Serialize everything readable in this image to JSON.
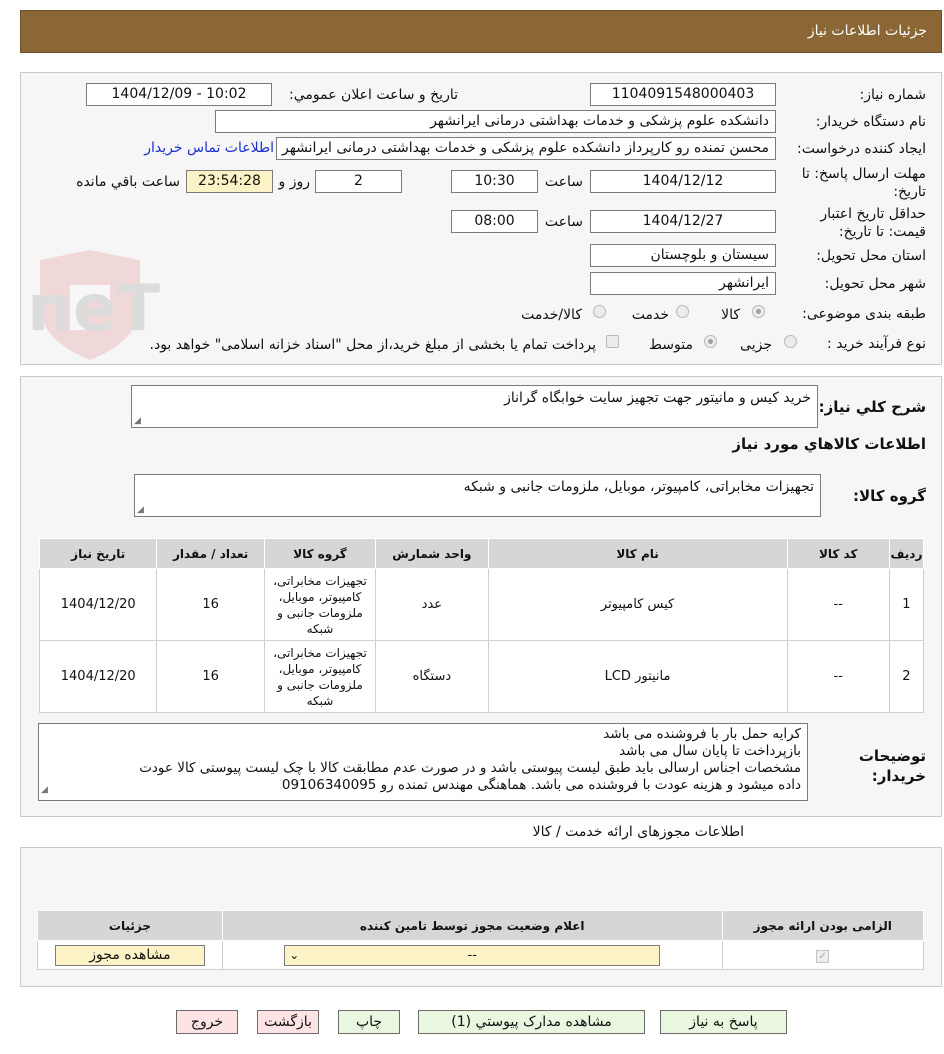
{
  "header": {
    "title": "جزئیات اطلاعات نیاز"
  },
  "watermark": {
    "text": "AriaTender.neT"
  },
  "form": {
    "need_number_label": "شماره نیاز:",
    "need_number": "1104091548000403",
    "announce_label": "تاريخ و ساعت اعلان عمومي:",
    "announce_value": "1404/12/09 - 10:02",
    "buyer_org_label": "نام دستگاه خریدار:",
    "buyer_org": "دانشکده علوم پزشکی و خدمات بهداشتی درمانی ایرانشهر",
    "requester_label": "ایجاد کننده درخواست:",
    "requester": "محسن تمنده رو کارپرداز دانشکده علوم پزشکی و خدمات بهداشتی درمانی ایرانشهر",
    "contact_link": "اطلاعات تماس خریدار",
    "deadline_label": "مهلت ارسال پاسخ: تا تاریخ:",
    "deadline_date": "1404/12/12",
    "time_label": "ساعت",
    "deadline_time": "10:30",
    "days_value": "2",
    "days_label": "روز و",
    "remaining_time": "23:54:28",
    "remaining_label": "ساعت باقي مانده",
    "validity_label": "حداقل تاریخ اعتبار قیمت: تا تاریخ:",
    "validity_date": "1404/12/27",
    "validity_time": "08:00",
    "province_label": "استان محل تحویل:",
    "province": "سیستان و بلوچستان",
    "city_label": "شهر محل تحویل:",
    "city": "ایرانشهر",
    "category_label": "طبقه بندی موضوعی:",
    "category_options": [
      "کالا",
      "خدمت",
      "کالا/خدمت"
    ],
    "process_label": "نوع فرآیند خرید :",
    "process_options": [
      "جزیی",
      "متوسط"
    ],
    "payment_note": "پرداخت تمام یا بخشی از مبلغ خرید،از محل \"اسناد خزانه اسلامی\" خواهد بود."
  },
  "summary": {
    "desc_label": "شرح کلي نياز:",
    "desc_value": "خرید کیس و مانیتور جهت تجهیز سایت خوابگاه گراناز",
    "goods_info_title": "اطلاعات کالاهاي مورد نياز",
    "group_label": "گروه کالا:",
    "group_value": "تجهیزات مخابراتی، کامپیوتر، موبایل، ملزومات جانبی و شبکه"
  },
  "table": {
    "headers": [
      "ردیف",
      "کد کالا",
      "نام کالا",
      "واحد شمارش",
      "گروه کالا",
      "تعداد / مقدار",
      "تاریخ نیاز"
    ],
    "rows": [
      {
        "row": "1",
        "code": "--",
        "name": "کیس کامپیوتر",
        "unit": "عدد",
        "group": "تجهیزات مخابراتی، کامپیوتر، موبایل، ملزومات جانبی و شبکه",
        "qty": "16",
        "date": "1404/12/20"
      },
      {
        "row": "2",
        "code": "--",
        "name": "مانیتور LCD",
        "unit": "دستگاه",
        "group": "تجهیزات مخابراتی، کامپیوتر، موبایل، ملزومات جانبی و شبکه",
        "qty": "16",
        "date": "1404/12/20"
      }
    ]
  },
  "notes": {
    "label": "توضیحات خریدار:",
    "lines": [
      "کرایه حمل بار با فروشنده می باشد",
      "بازپرداخت تا پایان سال می باشد",
      "مشخصات اجناس ارسالی باید طبق لیست پیوستی باشد و در صورت عدم مطابقت کالا با چک لیست پیوستی کالا عودت",
      "داده میشود و هزینه عودت با فروشنده می باشد. هماهنگی مهندس تمنده رو 09106340095"
    ]
  },
  "permits": {
    "section_title": "اطلاعات مجوزهای ارائه خدمت / کالا",
    "headers": [
      "الزامی بودن ارائه مجوز",
      "اعلام وضعیت مجوز توسط تامین کننده",
      "جزئیات"
    ],
    "select_value": "--",
    "view_button": "مشاهده مجوز"
  },
  "buttons": {
    "reply": "پاسخ به نیاز",
    "attachments": "مشاهده مدارک پیوستي (1)",
    "print": "چاپ",
    "back": "بازگشت",
    "exit": "خروج"
  }
}
